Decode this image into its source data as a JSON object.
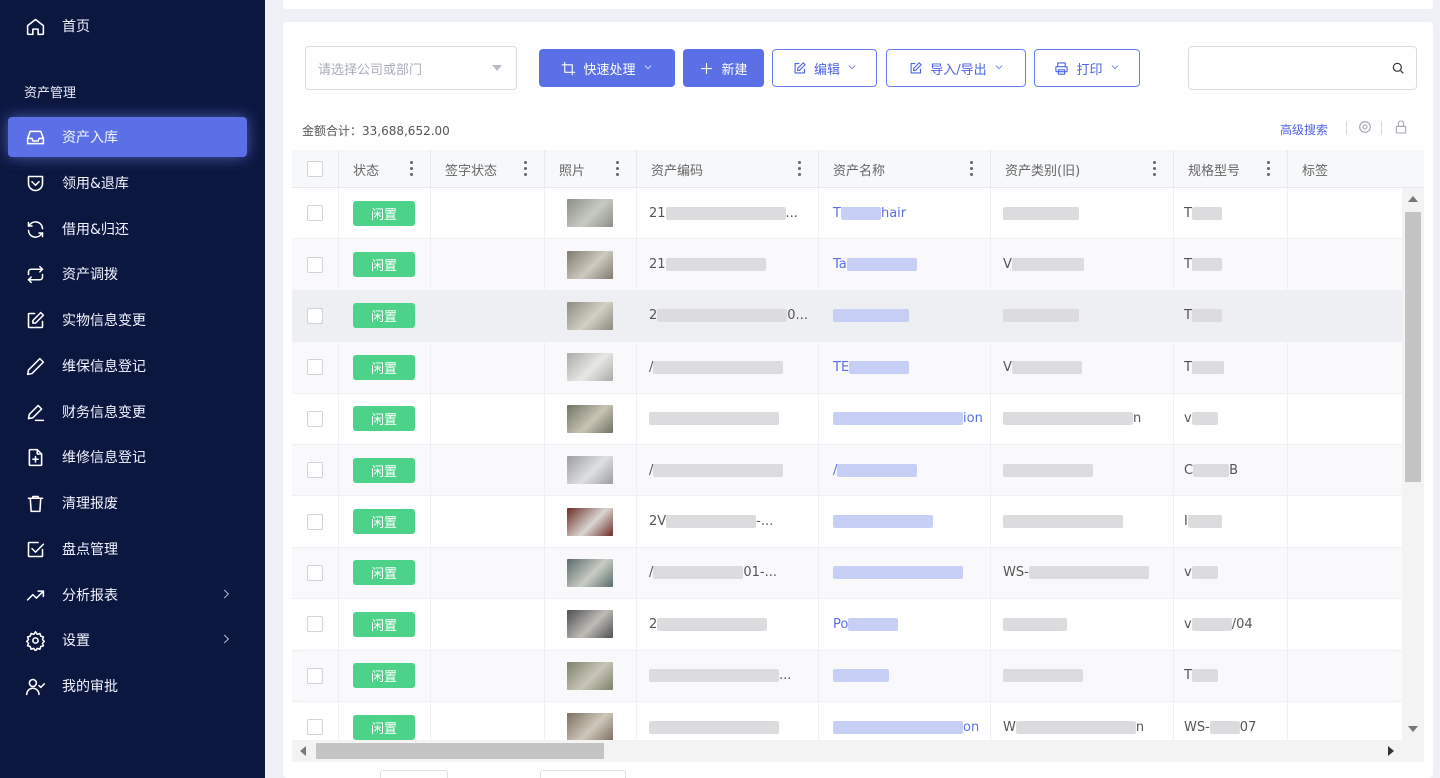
{
  "sidebar": {
    "home": "首页",
    "group_title": "资产管理",
    "items": [
      {
        "label": "资产入库",
        "icon": "inbox-icon"
      },
      {
        "label": "领用&退库",
        "icon": "shield-icon"
      },
      {
        "label": "借用&归还",
        "icon": "refresh-icon"
      },
      {
        "label": "资产调拨",
        "icon": "swap-icon"
      },
      {
        "label": "实物信息变更",
        "icon": "edit-box-icon"
      },
      {
        "label": "维保信息登记",
        "icon": "pen-icon"
      },
      {
        "label": "财务信息变更",
        "icon": "pen-line-icon"
      },
      {
        "label": "维修信息登记",
        "icon": "file-plus-icon"
      },
      {
        "label": "清理报废",
        "icon": "trash-icon"
      },
      {
        "label": "盘点管理",
        "icon": "check-square-icon"
      },
      {
        "label": "分析报表",
        "icon": "trend-icon"
      },
      {
        "label": "设置",
        "icon": "gear-icon"
      },
      {
        "label": "我的审批",
        "icon": "user-check-icon"
      }
    ]
  },
  "toolbar": {
    "company_placeholder": "请选择公司或部门",
    "quick_label": "快速处理",
    "new_label": "新建",
    "edit_label": "编辑",
    "import_label": "导入/导出",
    "print_label": "打印"
  },
  "summary": {
    "total_label": "金额合计：33,688,652.00",
    "advanced_search": "高级搜索"
  },
  "columns": [
    "状态",
    "签字状态",
    "照片",
    "资产编码",
    "资产名称",
    "资产类别(旧)",
    "规格型号",
    "标签"
  ],
  "rows": [
    {
      "status": "闲置",
      "code": "21",
      "code_tail": "...",
      "name": "T",
      "name_tail": "hair",
      "category": "",
      "model": "T"
    },
    {
      "status": "闲置",
      "code": "21",
      "code_tail": "",
      "name": "Ta",
      "name_tail": "",
      "category": "V",
      "model": "T"
    },
    {
      "status": "闲置",
      "code": "2",
      "code_tail": "0...",
      "name": "",
      "name_tail": "",
      "category": "",
      "model": "T"
    },
    {
      "status": "闲置",
      "code": "/",
      "code_tail": "",
      "name": "TE",
      "name_tail": "",
      "category": "V",
      "model": "T"
    },
    {
      "status": "闲置",
      "code": "",
      "code_tail": "",
      "name": "",
      "name_tail": "ion",
      "category": "",
      "category_tail": "n",
      "model": "v"
    },
    {
      "status": "闲置",
      "code": "/",
      "code_tail": "",
      "name": "/",
      "name_tail": "",
      "category": "",
      "model": "C",
      "model_tail": "B"
    },
    {
      "status": "闲置",
      "code": "2V",
      "code_tail": "-...",
      "name": "",
      "name_tail": "",
      "category": "",
      "model": "I"
    },
    {
      "status": "闲置",
      "code": "/",
      "code_tail": "01-...",
      "name": "",
      "name_tail": "",
      "category": "WS-",
      "model": "v"
    },
    {
      "status": "闲置",
      "code": "2",
      "code_tail": "",
      "name": "Po",
      "name_tail": "",
      "category": "",
      "model": "v",
      "model_tail": "/04"
    },
    {
      "status": "闲置",
      "code": "",
      "code_tail": "...",
      "name": "",
      "name_tail": "",
      "category": "",
      "model": "T"
    },
    {
      "status": "闲置",
      "code": "",
      "code_tail": "",
      "name": "",
      "name_tail": "on",
      "category": "W",
      "category_tail": "n",
      "model": "WS-",
      "model_tail": "07"
    }
  ],
  "colors": {
    "sidebar_bg": "#0c1740",
    "accent": "#5b6fe6",
    "status_idle": "#4cd389"
  }
}
